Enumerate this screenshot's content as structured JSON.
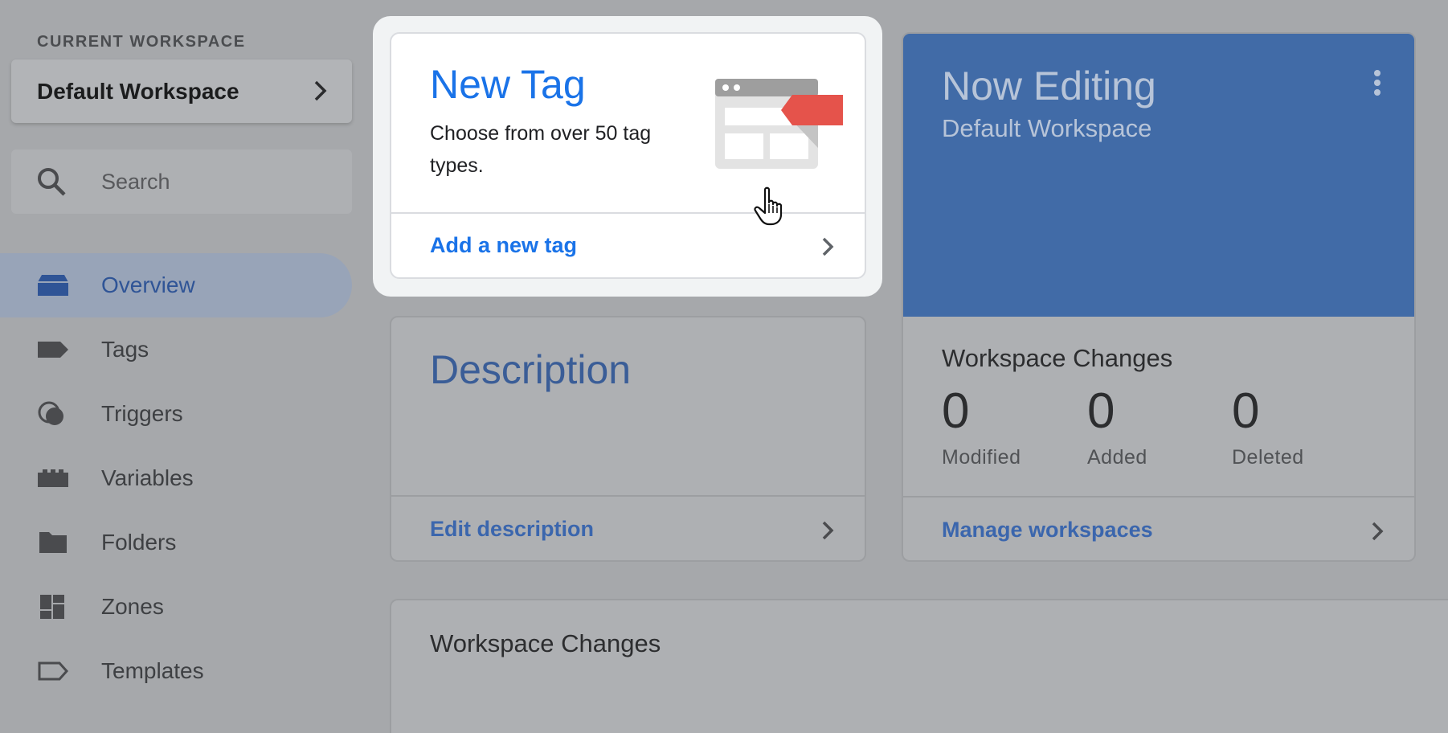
{
  "sidebar": {
    "current_workspace_label": "CURRENT WORKSPACE",
    "workspace_name": "Default Workspace",
    "search": {
      "placeholder": "Search",
      "value": ""
    },
    "nav": [
      {
        "label": "Overview",
        "icon": "overview-icon",
        "active": true
      },
      {
        "label": "Tags",
        "icon": "tag-icon",
        "active": false
      },
      {
        "label": "Triggers",
        "icon": "trigger-icon",
        "active": false
      },
      {
        "label": "Variables",
        "icon": "variables-icon",
        "active": false
      },
      {
        "label": "Folders",
        "icon": "folder-icon",
        "active": false
      },
      {
        "label": "Zones",
        "icon": "zones-icon",
        "active": false
      },
      {
        "label": "Templates",
        "icon": "template-icon",
        "active": false
      }
    ]
  },
  "new_tag_card": {
    "title": "New Tag",
    "description": "Choose from over 50 tag types.",
    "action": "Add a new tag"
  },
  "description_card": {
    "title": "Description",
    "action": "Edit description"
  },
  "now_editing_card": {
    "title": "Now Editing",
    "subtitle": "Default Workspace",
    "changes_title": "Workspace Changes",
    "stats": [
      {
        "value": "0",
        "label": "Modified"
      },
      {
        "value": "0",
        "label": "Added"
      },
      {
        "value": "0",
        "label": "Deleted"
      }
    ],
    "action": "Manage workspaces"
  },
  "workspace_changes_card": {
    "title": "Workspace Changes"
  },
  "colors": {
    "accent_blue": "#1a73e8",
    "editing_header": "#416ba7",
    "tag_red": "#e5534b"
  }
}
